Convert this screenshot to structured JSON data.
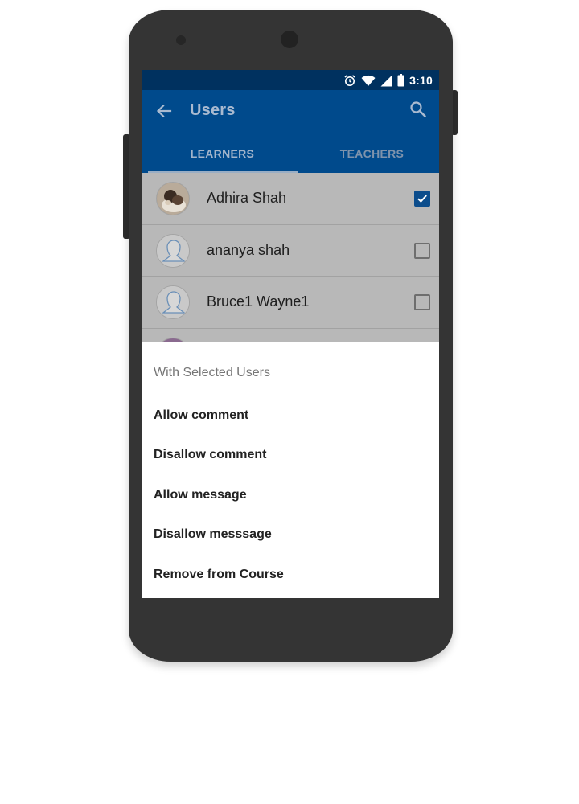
{
  "status_bar": {
    "time": "3:10",
    "icons": [
      "alarm-icon",
      "wifi-icon",
      "signal-icon",
      "battery-icon"
    ]
  },
  "app_bar": {
    "title": "Users",
    "back_icon": "arrow-left-icon",
    "search_icon": "search-icon"
  },
  "tabs": [
    {
      "label": "LEARNERS",
      "selected": true
    },
    {
      "label": "TEACHERS",
      "selected": false
    }
  ],
  "users": [
    {
      "name": "Adhira Shah",
      "avatar": "photo",
      "checked": true
    },
    {
      "name": "ananya shah",
      "avatar": "default-person",
      "checked": false
    },
    {
      "name": "Bruce1 Wayne1",
      "avatar": "default-person",
      "checked": false
    }
  ],
  "sheet": {
    "title": "With Selected Users",
    "actions": [
      "Allow comment",
      "Disallow comment",
      "Allow message",
      "Disallow messsage",
      "Remove from Course"
    ]
  },
  "colors": {
    "status_bar": "#00315f",
    "app_bar": "#004a8c",
    "checkbox_checked": "#0c4d8c",
    "scrim_row": "#b8b8b8"
  }
}
